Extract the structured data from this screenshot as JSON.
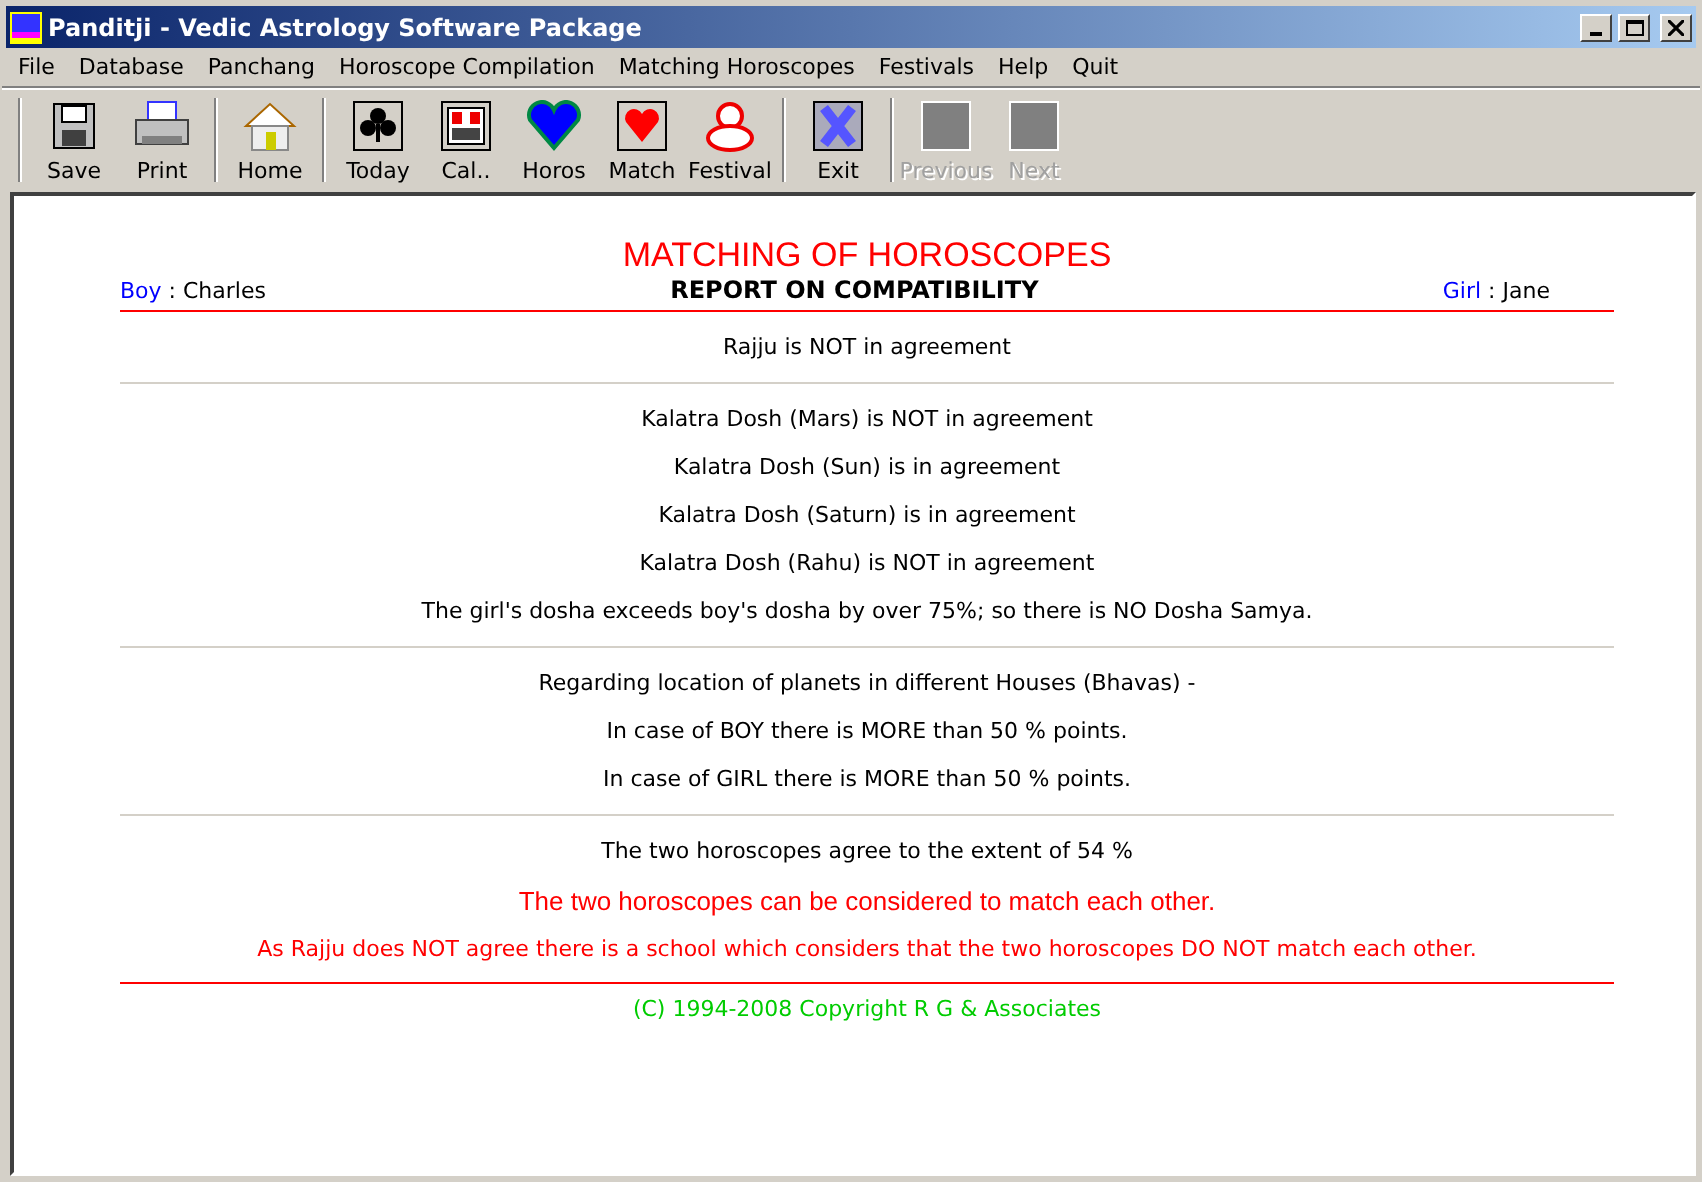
{
  "window": {
    "title": "Panditji - Vedic Astrology Software Package"
  },
  "menu": [
    "File",
    "Database",
    "Panchang",
    "Horoscope Compilation",
    "Matching Horoscopes",
    "Festivals",
    "Help",
    "Quit"
  ],
  "toolbar": [
    [
      {
        "label": "Save",
        "disabled": false
      },
      {
        "label": "Print",
        "disabled": false
      }
    ],
    [
      {
        "label": "Home",
        "disabled": false
      }
    ],
    [
      {
        "label": "Today",
        "disabled": false
      },
      {
        "label": "Cal..",
        "disabled": false
      },
      {
        "label": "Horos",
        "disabled": false
      },
      {
        "label": "Match",
        "disabled": false
      },
      {
        "label": "Festival",
        "disabled": false
      }
    ],
    [
      {
        "label": "Exit",
        "disabled": false
      }
    ],
    [
      {
        "label": "Previous",
        "disabled": true
      },
      {
        "label": "Next",
        "disabled": true
      }
    ]
  ],
  "report": {
    "heading": "MATCHING OF HOROSCOPES",
    "subheading": "REPORT ON COMPATIBILITY",
    "boy": {
      "label": "Boy",
      "value": ": Charles"
    },
    "girl": {
      "label": "Girl",
      "value": ": Jane"
    },
    "sections": [
      {
        "lines": [
          {
            "kind": "normal",
            "text": "Rajju is NOT in agreement"
          }
        ]
      },
      {
        "lines": [
          {
            "kind": "normal",
            "text": "Kalatra Dosh (Mars) is NOT in agreement"
          },
          {
            "kind": "normal",
            "text": "Kalatra Dosh (Sun) is in agreement"
          },
          {
            "kind": "normal",
            "text": "Kalatra Dosh (Saturn) is in agreement"
          },
          {
            "kind": "normal",
            "text": "Kalatra Dosh (Rahu) is NOT in agreement"
          },
          {
            "kind": "normal",
            "text": "The girl's dosha exceeds boy's dosha by over 75%; so there is NO Dosha Samya."
          }
        ]
      },
      {
        "lines": [
          {
            "kind": "normal",
            "text": "Regarding location of planets in different Houses (Bhavas) -"
          },
          {
            "kind": "normal",
            "text": "In case of BOY there is MORE than 50 % points."
          },
          {
            "kind": "normal",
            "text": "In case of GIRL there is MORE than 50 % points."
          }
        ]
      },
      {
        "lines": [
          {
            "kind": "normal",
            "text": "The two horoscopes agree to the extent of 54 %"
          },
          {
            "kind": "conclusion",
            "text": "The two horoscopes can be considered to match each other."
          },
          {
            "kind": "warning",
            "text": "As Rajju does NOT agree there is a school which considers that the two horoscopes DO NOT match each other."
          }
        ]
      }
    ],
    "copyright": "(C) 1994-2008 Copyright R G & Associates"
  }
}
